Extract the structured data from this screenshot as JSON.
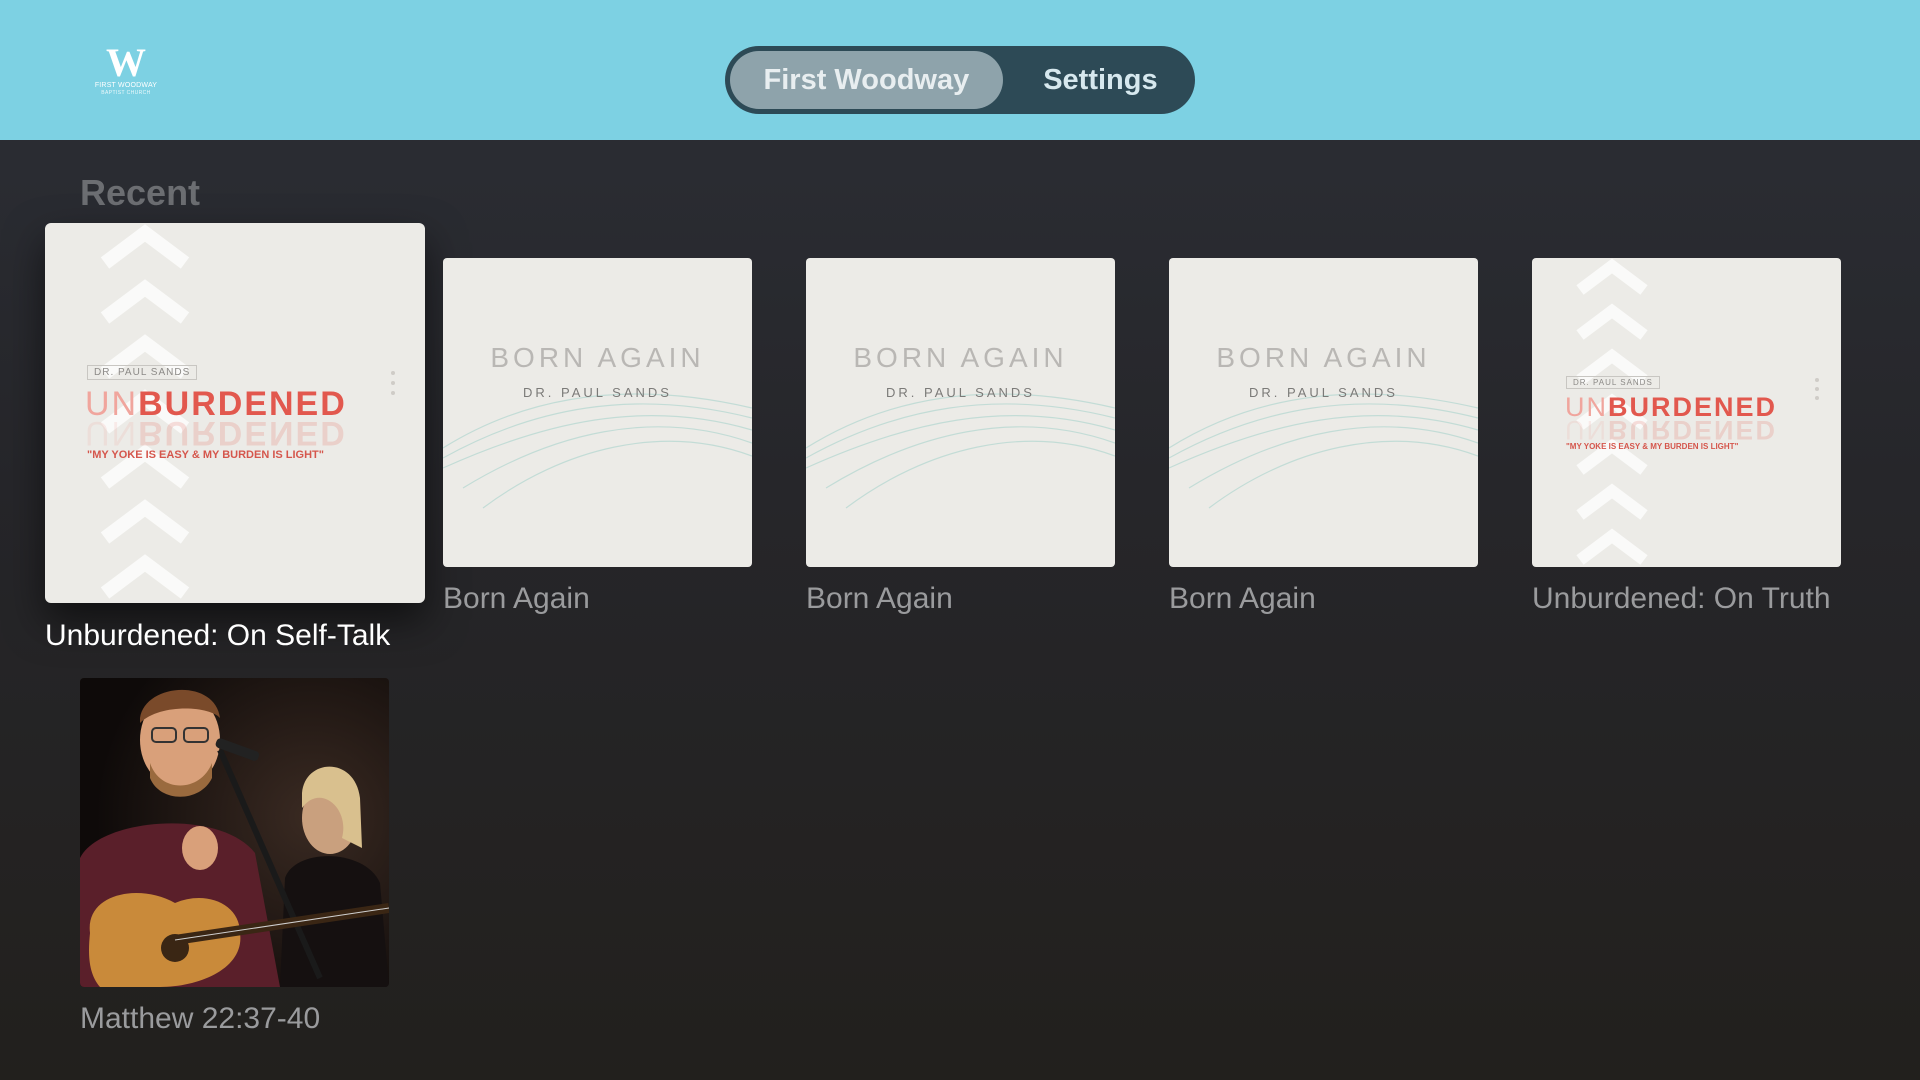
{
  "header": {
    "logo": {
      "mark": "W",
      "line1": "FIRST WOODWAY",
      "line2": "BAPTIST CHURCH"
    },
    "tabs": [
      {
        "label": "First Woodway",
        "active": true
      },
      {
        "label": "Settings",
        "active": false
      }
    ]
  },
  "section": {
    "title": "Recent"
  },
  "items": [
    {
      "title": "Unburdened: On Self-Talk",
      "focused": true,
      "art": {
        "pre": "DR. PAUL SANDS",
        "title_a": "UN",
        "title_b": "BURDENED",
        "quote": "\"MY YOKE IS EASY & MY BURDEN IS LIGHT\""
      }
    },
    {
      "title": "Born Again",
      "art": {
        "title": "BORN AGAIN",
        "sub": "DR. PAUL SANDS"
      }
    },
    {
      "title": "Born Again",
      "art": {
        "title": "BORN AGAIN",
        "sub": "DR. PAUL SANDS"
      }
    },
    {
      "title": "Born Again",
      "art": {
        "title": "BORN AGAIN",
        "sub": "DR. PAUL SANDS"
      }
    },
    {
      "title": "Unburdened: On Truth",
      "art": {
        "pre": "DR. PAUL SANDS",
        "title_a": "UN",
        "title_b": "BURDENED",
        "quote": "\"MY YOKE IS EASY & MY BURDEN IS LIGHT\""
      }
    },
    {
      "title": "Matthew 22:37-40",
      "art": {
        "kind": "photo"
      }
    }
  ],
  "colors": {
    "header_bg": "#7dd1e3",
    "tab_pill_bg": "#2d4a56",
    "tab_active_bg": "#8ea3ab",
    "accent_red": "#e2584e"
  }
}
